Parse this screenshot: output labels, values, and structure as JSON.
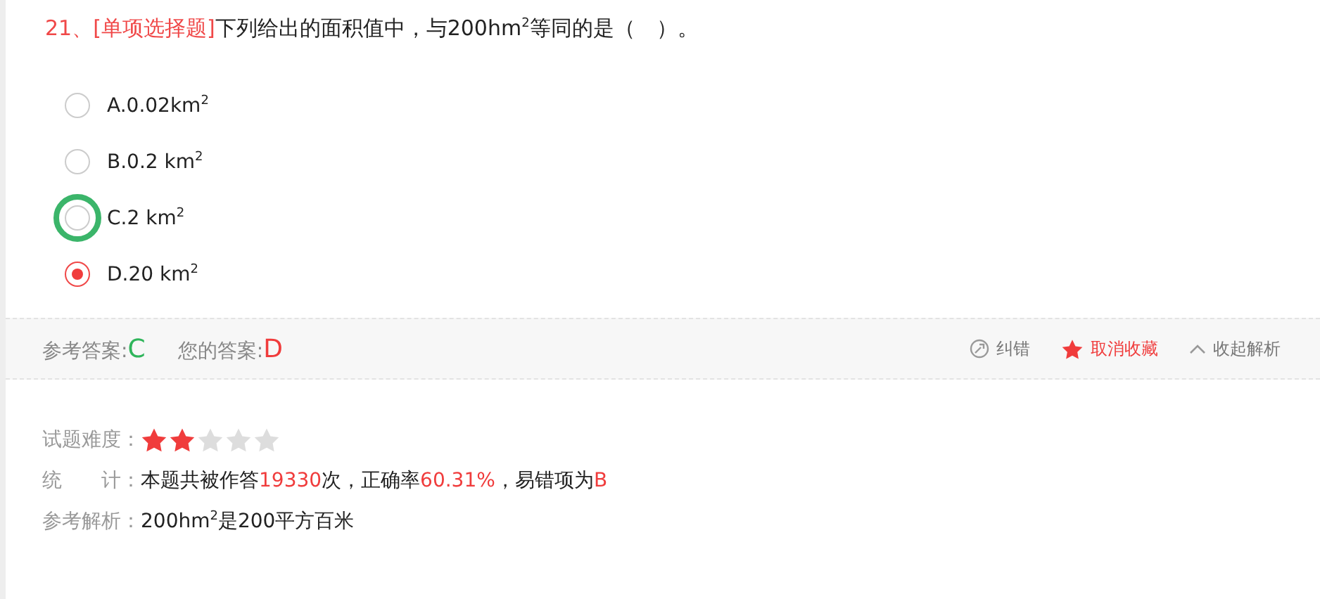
{
  "question": {
    "number": "21、",
    "type": "[单项选择题]",
    "text": "下列给出的面积值中，与200hm$^{2}$等同的是（　）。"
  },
  "options": [
    {
      "label": "A.0.02km$^{2}$",
      "selected": false,
      "circled": false
    },
    {
      "label": "B.0.2 km$^{2}$",
      "selected": false,
      "circled": false
    },
    {
      "label": "C.2 km$^{2}$",
      "selected": false,
      "circled": true
    },
    {
      "label": "D.20 km$^{2}$",
      "selected": true,
      "circled": false
    }
  ],
  "answer_bar": {
    "reference_label": "参考答案:",
    "reference_value": "C",
    "yours_label": "您的答案:",
    "yours_value": "D",
    "actions": [
      {
        "kind": "report",
        "label": "纠错"
      },
      {
        "kind": "favorite",
        "label": "取消收藏"
      },
      {
        "kind": "collapse",
        "label": "收起解析"
      }
    ]
  },
  "difficulty": {
    "label": "试题难度：",
    "stars": 2
  },
  "stats": {
    "label_parts": [
      "统",
      "计："
    ],
    "parts": [
      {
        "text": "本题共被作答",
        "highlight": false
      },
      {
        "text": "19330",
        "highlight": true
      },
      {
        "text": "次，正确率",
        "highlight": false
      },
      {
        "text": "60.31%",
        "highlight": true
      },
      {
        "text": "，易错项为",
        "highlight": false
      },
      {
        "text": "B",
        "highlight": true
      }
    ]
  },
  "analysis": {
    "label": "参考解析：",
    "text": "200hm$^{2}$是200平方百米"
  }
}
